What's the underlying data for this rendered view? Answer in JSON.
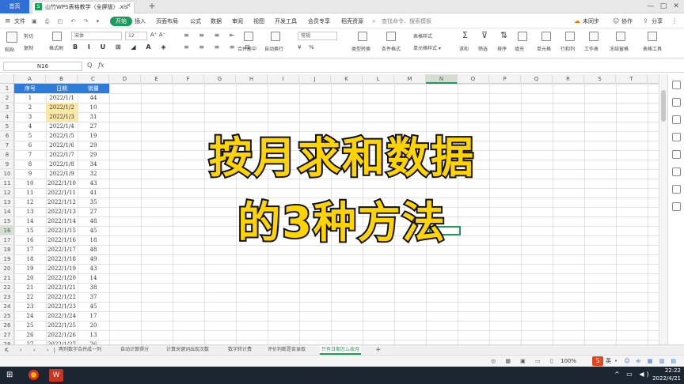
{
  "tabs": {
    "home": "首页",
    "doc": "山竹WPS表格教学（全屏版）.xls",
    "doc_icon": "S"
  },
  "menu": [
    "文件",
    "开始",
    "插入",
    "页面布局",
    "公式",
    "数据",
    "审阅",
    "视图",
    "开发工具",
    "会员专享",
    "稻壳资源"
  ],
  "menu_active_index": 1,
  "menu_right": {
    "search": "查找命令、搜索模板",
    "sync": "未同步",
    "collab": "协作",
    "share": "分享"
  },
  "ribbon": {
    "font_name": "宋体",
    "font_size": "12",
    "items": [
      "粘贴",
      "剪切",
      "复制",
      "格式刷",
      "合并居中",
      "自动换行",
      "常规",
      "类型转换",
      "条件格式",
      "表格样式",
      "求和",
      "筛选",
      "排序",
      "填充",
      "单元格",
      "行和列",
      "工作表",
      "冻结窗格",
      "表格工具"
    ],
    "currency": "¥",
    "percent": "%"
  },
  "formula": {
    "namebox": "N16",
    "fx": "fx",
    "zoom_icon": "Q",
    "value": ""
  },
  "columns": [
    "A",
    "B",
    "C",
    "D",
    "E",
    "F",
    "G",
    "H",
    "I",
    "J",
    "K",
    "L",
    "M",
    "N",
    "O",
    "P",
    "Q",
    "R",
    "S",
    "T"
  ],
  "selected_column": "N",
  "rows": [
    "1",
    "2",
    "3",
    "4",
    "5",
    "6",
    "7",
    "8",
    "9",
    "10",
    "11",
    "12",
    "13",
    "14",
    "15",
    "16",
    "17",
    "18",
    "19",
    "20",
    "21",
    "22",
    "23",
    "24",
    "25",
    "26",
    "27",
    "28"
  ],
  "selected_row": "16",
  "table": {
    "headers": [
      "序号",
      "日期",
      "销量"
    ],
    "records": [
      [
        "1",
        "2022/1/1",
        "44"
      ],
      [
        "2",
        "2022/1/2",
        "10"
      ],
      [
        "3",
        "2022/1/3",
        "31"
      ],
      [
        "4",
        "2022/1/4",
        "27"
      ],
      [
        "5",
        "2022/1/5",
        "19"
      ],
      [
        "6",
        "2022/1/6",
        "29"
      ],
      [
        "7",
        "2022/1/7",
        "29"
      ],
      [
        "8",
        "2022/1/8",
        "34"
      ],
      [
        "9",
        "2022/1/9",
        "32"
      ],
      [
        "10",
        "2022/1/10",
        "43"
      ],
      [
        "11",
        "2022/1/11",
        "41"
      ],
      [
        "12",
        "2022/1/12",
        "35"
      ],
      [
        "13",
        "2022/1/13",
        "27"
      ],
      [
        "14",
        "2022/1/14",
        "48"
      ],
      [
        "15",
        "2022/1/15",
        "45"
      ],
      [
        "16",
        "2022/1/16",
        "18"
      ],
      [
        "17",
        "2022/1/17",
        "48"
      ],
      [
        "18",
        "2022/1/18",
        "49"
      ],
      [
        "19",
        "2022/1/19",
        "43"
      ],
      [
        "20",
        "2022/1/20",
        "14"
      ],
      [
        "21",
        "2022/1/21",
        "38"
      ],
      [
        "22",
        "2022/1/22",
        "37"
      ],
      [
        "23",
        "2022/1/23",
        "45"
      ],
      [
        "24",
        "2022/1/24",
        "17"
      ],
      [
        "25",
        "2022/1/25",
        "20"
      ],
      [
        "26",
        "2022/1/26",
        "13"
      ],
      [
        "27",
        "2022/1/27",
        "26"
      ]
    ]
  },
  "overlay": {
    "line1": "按月求和数据",
    "line2": "的3种方法"
  },
  "sheet_tabs": [
    "两列数字合并成一列",
    "自动计算得分",
    "计算关键词出现次数",
    "数字转计费",
    "评价判断是否录取",
    "只有日期怎么按月"
  ],
  "active_sheet_index": 5,
  "status": {
    "zoom": "100%",
    "input_method": "英"
  },
  "taskbar": {
    "time": "22:22",
    "date": "2022/4/21"
  },
  "colors": {
    "accent": "#1e9b5a",
    "header_blue": "#2f7bd8",
    "highlight": "#fbe8a6",
    "overlay_yellow": "#ffd400"
  }
}
